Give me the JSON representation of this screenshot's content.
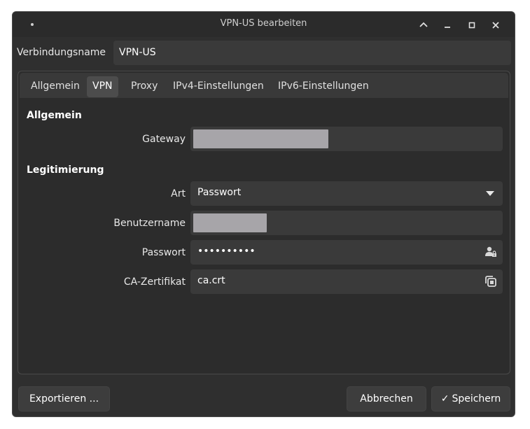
{
  "window": {
    "title": "VPN-US bearbeiten"
  },
  "connection_name": {
    "label": "Verbindungsname",
    "value": "VPN-US"
  },
  "tabs": [
    {
      "label": "Allgemein",
      "active": false
    },
    {
      "label": "VPN",
      "active": true
    },
    {
      "label": "Proxy",
      "active": false
    },
    {
      "label": "IPv4-Einstellungen",
      "active": false
    },
    {
      "label": "IPv6-Einstellungen",
      "active": false
    }
  ],
  "vpn": {
    "general_section": "Allgemein",
    "gateway_label": "Gateway",
    "auth_section": "Legitimierung",
    "type_label": "Art",
    "type_value": "Passwort",
    "username_label": "Benutzername",
    "password_label": "Passwort",
    "password_value": "••••••••••",
    "ca_label": "CA-Zertifikat",
    "ca_value": "ca.crt"
  },
  "buttons": {
    "export": "Exportieren ...",
    "cancel": "Abbrechen",
    "save": "Speichern",
    "save_check": "✓"
  },
  "colors": {
    "background": "#2f2f2f",
    "field": "#3a3a3a",
    "redaction": "#a7a5a9"
  },
  "icons": {
    "password_field": "user-lock-icon",
    "certificate_field": "copy-files-icon",
    "dropdown": "triangle-down-icon"
  }
}
